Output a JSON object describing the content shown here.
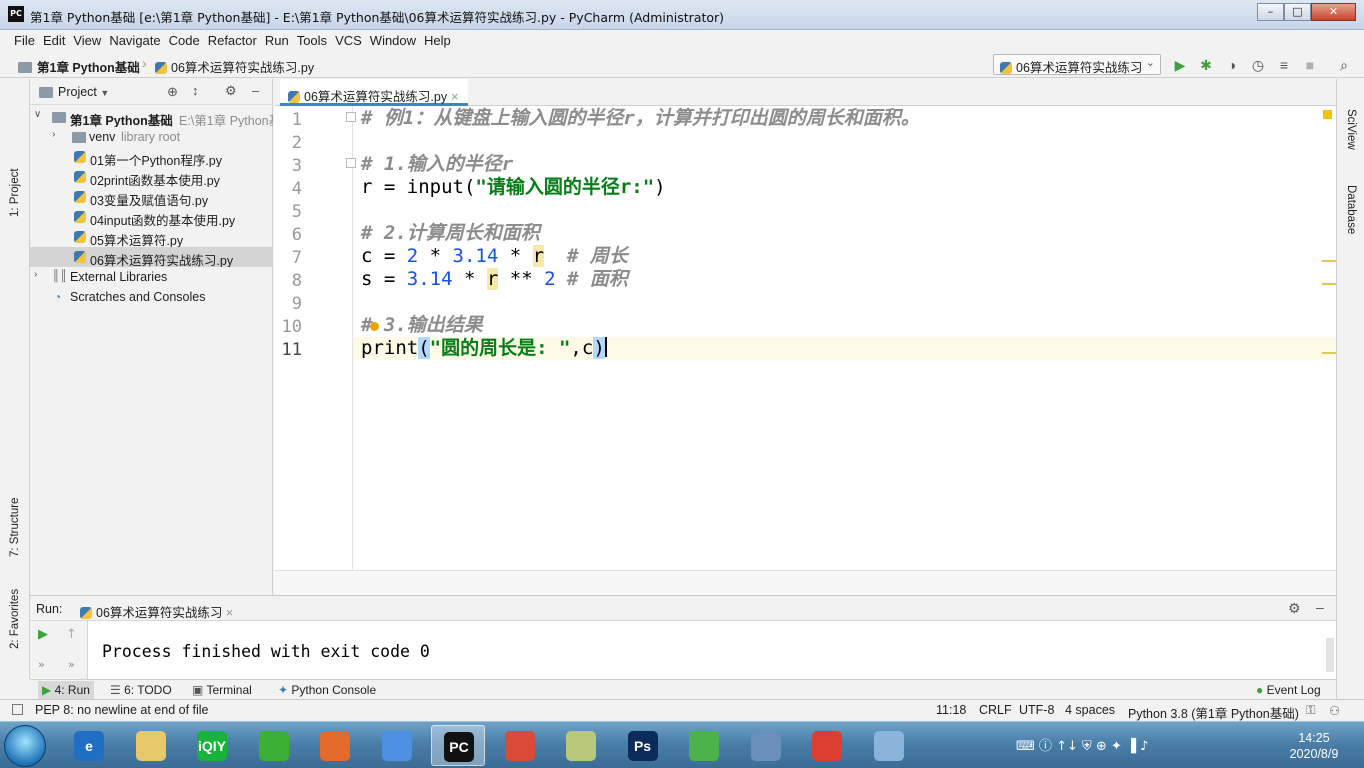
{
  "window": {
    "title": "第1章 Python基础 [e:\\第1章 Python基础] - E:\\第1章 Python基础\\06算术运算符实战练习.py - PyCharm (Administrator)",
    "logo": "PC",
    "minimize": "–",
    "maximize": "□",
    "close": "✕"
  },
  "menu": [
    "File",
    "Edit",
    "View",
    "Navigate",
    "Code",
    "Refactor",
    "Run",
    "Tools",
    "VCS",
    "Window",
    "Help"
  ],
  "navbar": {
    "project": "第1章 Python基础",
    "file": "06算术运算符实战练习.py",
    "run_config": "06算术运算符实战练习",
    "run_config_arrow": "⌵"
  },
  "left_stripe": {
    "project": "1: Project",
    "structure": "7: Structure",
    "favorites": "2: Favorites"
  },
  "right_stripe": {
    "sciview": "SciView",
    "database": "Database"
  },
  "project_panel": {
    "title": "Project",
    "root_name": "第1章 Python基础",
    "root_path": "E:\\第1章 Python基础",
    "venv": "venv",
    "venv_hint": "library root",
    "files": [
      "01第一个Python程序.py",
      "02print函数基本使用.py",
      "03变量及赋值语句.py",
      "04input函数的基本使用.py",
      "05算术运算符.py",
      "06算术运算符实战练习.py"
    ],
    "external_libraries": "External Libraries",
    "scratches": "Scratches and Consoles"
  },
  "editor": {
    "tab_label": "06算术运算符实战练习.py",
    "tab_close": "×",
    "line_numbers": [
      "1",
      "2",
      "3",
      "4",
      "5",
      "6",
      "7",
      "8",
      "9",
      "10",
      "11"
    ],
    "current_line": 11,
    "lines": {
      "l1": "# 例1：从键盘上输入圆的半径r，计算并打印出圆的周长和面积。",
      "l3": "# 1.输入的半径r",
      "l4_code": "r = input(",
      "l4_str": "\"请输入圆的半径r:\"",
      "l4_end": ")",
      "l6": "# 2.计算周长和面积",
      "l7_a": "c = ",
      "l7_n1": "2",
      "l7_b": " * ",
      "l7_n2": "3.14",
      "l7_c": " * ",
      "l7_r": "r",
      "l7_cmt": "  # 周长",
      "l8_a": "s = ",
      "l8_n1": "3.14",
      "l8_b": " * ",
      "l8_r": "r",
      "l8_c": " ** ",
      "l8_n2": "2",
      "l8_cmt": " # 面积",
      "l10_hash": "#",
      "l10_rest": " 3.输出结果",
      "l11_fn": "print",
      "l11_open": "(",
      "l11_str": "\"圆的周长是: \"",
      "l11_mid": ",c",
      "l11_close": ")"
    }
  },
  "run_panel": {
    "label": "Run:",
    "tab": "06算术运算符实战练习",
    "tab_close": "×",
    "output": "Process finished with exit code 0"
  },
  "tool_tabs": {
    "run": "4: Run",
    "todo": "6: TODO",
    "terminal": "Terminal",
    "python_console": "Python Console",
    "event_log": "Event Log"
  },
  "status": {
    "message": "PEP 8: no newline at end of file",
    "position": "11:18",
    "line_sep": "CRLF",
    "encoding": "UTF-8",
    "indent": "4 spaces",
    "interpreter": "Python 3.8 (第1章 Python基础)"
  },
  "taskbar": {
    "apps": [
      {
        "name": "ie",
        "glyph": "e",
        "color": "#1f6fc5"
      },
      {
        "name": "explorer",
        "glyph": "",
        "color": "#e8c66a"
      },
      {
        "name": "iqiyi",
        "glyph": "iQIY",
        "color": "#17b33a"
      },
      {
        "name": "wechat",
        "glyph": "",
        "color": "#3cb034"
      },
      {
        "name": "mic",
        "glyph": "",
        "color": "#e46b2a"
      },
      {
        "name": "feishu",
        "glyph": "",
        "color": "#4d8fe0"
      },
      {
        "name": "pycharm",
        "glyph": "PC",
        "color": "#111111"
      },
      {
        "name": "app-colors",
        "glyph": "",
        "color": "#d94a38"
      },
      {
        "name": "notepad",
        "glyph": "",
        "color": "#b7c87a"
      },
      {
        "name": "photoshop",
        "glyph": "Ps",
        "color": "#0b2c5a"
      },
      {
        "name": "sync",
        "glyph": "",
        "color": "#4cb34c"
      },
      {
        "name": "qq-mgr",
        "glyph": "",
        "color": "#6a8fb8"
      },
      {
        "name": "chrome",
        "glyph": "",
        "color": "#db3f31"
      },
      {
        "name": "notebook",
        "glyph": "",
        "color": "#8ab4d9"
      }
    ],
    "time": "14:25",
    "date": "2020/8/9"
  },
  "colors": {
    "accent": "#4083c9",
    "comment": "#8c8c8c",
    "number": "#1750eb",
    "string": "#067d17",
    "run_green": "#3ca23c"
  }
}
